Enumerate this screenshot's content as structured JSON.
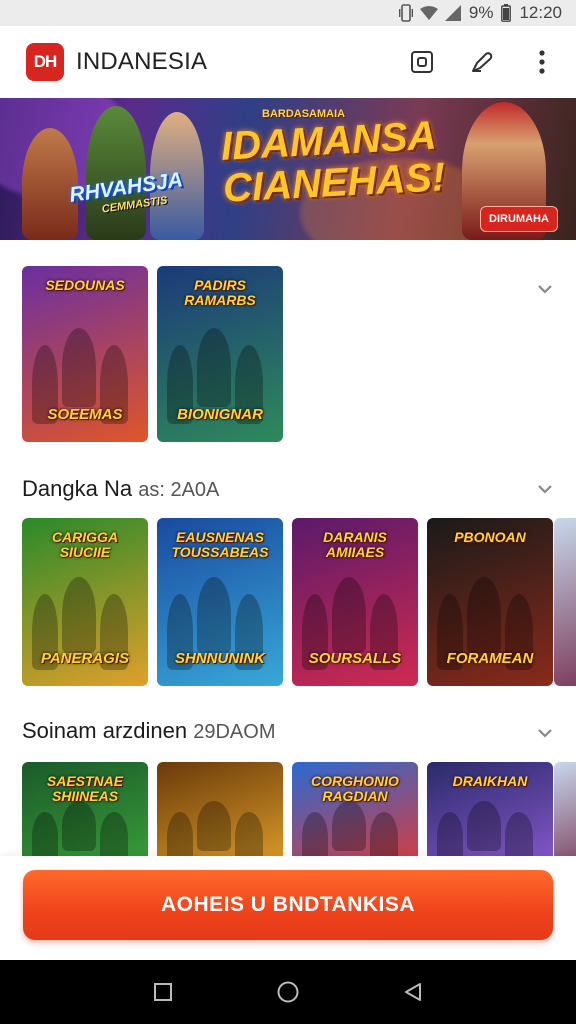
{
  "status": {
    "battery": "9%",
    "time": "12:20"
  },
  "app": {
    "logo_text": "DH",
    "title": "INDANESIA"
  },
  "banner": {
    "small_text": "BARDASAMAIA",
    "headline_line1": "IDAMANSA",
    "headline_line2": "CIANEHAS!",
    "left_logo": "RHVAHSJA",
    "left_logo_sub": "CEMMASTIS",
    "button": "DIRUMAHA"
  },
  "sections": [
    {
      "title": "",
      "cards": [
        {
          "top": "SEDOUNAS",
          "bottom": "SOEEMAS",
          "colors": [
            "#6a2fa0",
            "#e0562a"
          ]
        },
        {
          "top": "PADIRS\nRAMARBS",
          "bottom": "BIONIGNAR",
          "colors": [
            "#1c3a7a",
            "#2e8a5a"
          ]
        }
      ]
    },
    {
      "title": "Dangka Na",
      "subtitle": "as: 2A0A",
      "cards": [
        {
          "top": "CARIGGA\nSIUCIIE",
          "bottom": "PANERAGIS",
          "colors": [
            "#2a8a2a",
            "#e0a02a"
          ]
        },
        {
          "top": "EAUSNENAS\nTOUSSABEAS",
          "bottom": "SHNNUNINK",
          "colors": [
            "#1a4aa0",
            "#38a8d8"
          ]
        },
        {
          "top": "DARANIS\nAMIIAES",
          "bottom": "SOURSALLS",
          "colors": [
            "#5a1a6a",
            "#d02a50"
          ]
        },
        {
          "top": "PBONOAN",
          "bottom": "FORAMEAN",
          "colors": [
            "#1a1a1a",
            "#8a2a1a"
          ]
        }
      ]
    },
    {
      "title": "Soinam arzdinen",
      "subtitle": "29DAOM",
      "cards": [
        {
          "top": "SAESTNAE\nSHIINEAS",
          "bottom": "",
          "colors": [
            "#1a5a2a",
            "#3aa03a"
          ]
        },
        {
          "top": "",
          "bottom": "",
          "colors": [
            "#6a3a0a",
            "#e0a02a"
          ]
        },
        {
          "top": "CORGHONIO\nRAGDIAN",
          "bottom": "",
          "colors": [
            "#2a6ad0",
            "#e03a3a"
          ]
        },
        {
          "top": "DRAIKHAN",
          "bottom": "",
          "colors": [
            "#2a2a6a",
            "#8a5ad0"
          ]
        }
      ]
    }
  ],
  "cta": {
    "label": "AOHEIS U BNDTANKISA"
  },
  "colors": {
    "brand_red": "#d7261f",
    "cta_orange": "#f0431c"
  }
}
